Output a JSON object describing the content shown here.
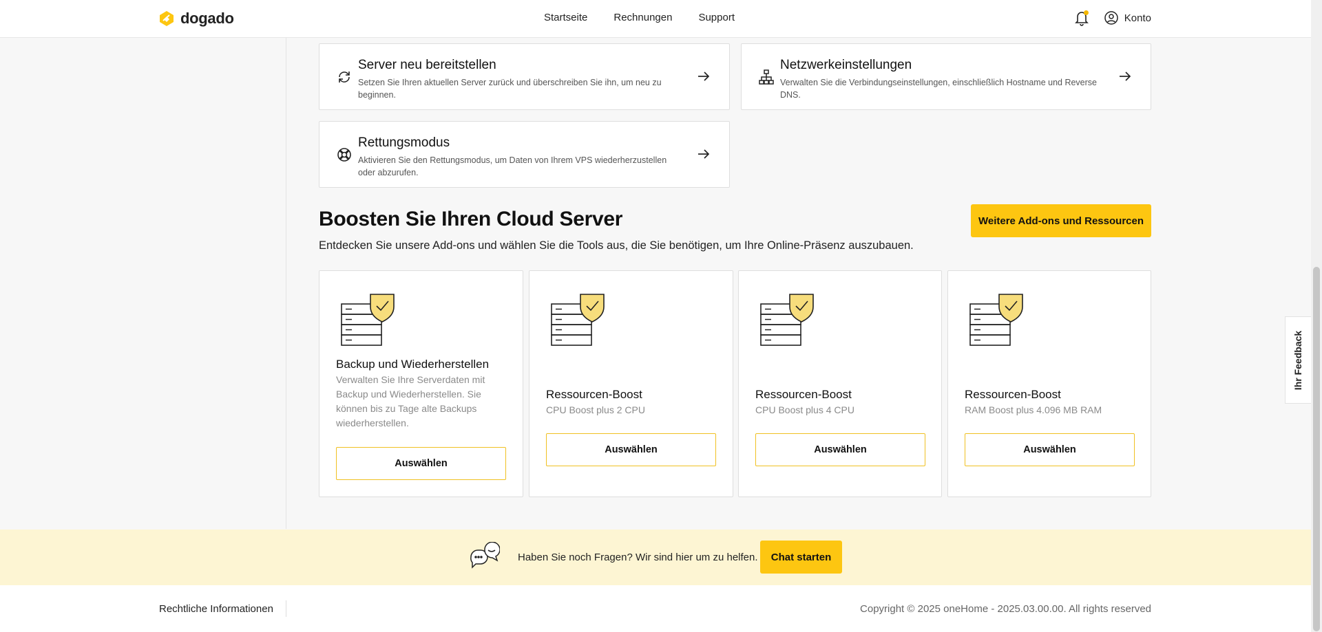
{
  "header": {
    "logo_text": "dogado",
    "nav": [
      "Startseite",
      "Rechnungen",
      "Support"
    ],
    "account_label": "Konto"
  },
  "actions": [
    {
      "title": "Server neu bereitstellen",
      "description": "Setzen Sie Ihren aktuellen Server zurück und überschreiben Sie ihn, um neu zu beginnen.",
      "icon": "refresh-icon"
    },
    {
      "title": "Netzwerkeinstellungen",
      "description": "Verwalten Sie die Verbindungseinstellungen, einschließlich Hostname und Reverse DNS.",
      "icon": "network-icon"
    },
    {
      "title": "Rettungsmodus",
      "description": "Aktivieren Sie den Rettungsmodus, um Daten von Ihrem VPS wiederherzustellen oder abzurufen.",
      "icon": "lifebuoy-icon"
    }
  ],
  "boost": {
    "title": "Boosten Sie Ihren Cloud Server",
    "subtitle": "Entdecken Sie unsere Add-ons und wählen Sie die Tools aus, die Sie benötigen, um Ihre Online-Präsenz auszubauen.",
    "more_button": "Weitere Add-ons und Ressourcen",
    "addons": [
      {
        "name": "Backup und Wiederherstellen",
        "info": "Verwalten Sie Ihre Serverdaten mit Backup und Wiederherstellen. Sie können bis zu Tage alte Backups wiederherstellen.",
        "button": "Auswählen"
      },
      {
        "name": "Ressourcen-Boost",
        "info": "CPU Boost plus 2 CPU",
        "button": "Auswählen"
      },
      {
        "name": "Ressourcen-Boost",
        "info": "CPU Boost plus 4 CPU",
        "button": "Auswählen"
      },
      {
        "name": "Ressourcen-Boost",
        "info": "RAM Boost plus 4.096 MB RAM",
        "button": "Auswählen"
      }
    ]
  },
  "help": {
    "text": "Haben Sie noch Fragen? Wir sind hier um zu helfen.",
    "button": "Chat starten"
  },
  "footer": {
    "legal": "Rechtliche Informationen",
    "copyright": "Copyright © 2025 oneHome - 2025.03.00.00. All rights reserved"
  },
  "feedback_label": "Ihr Feedback",
  "colors": {
    "accent": "#fdc611",
    "help_band": "#fdf5d3"
  }
}
